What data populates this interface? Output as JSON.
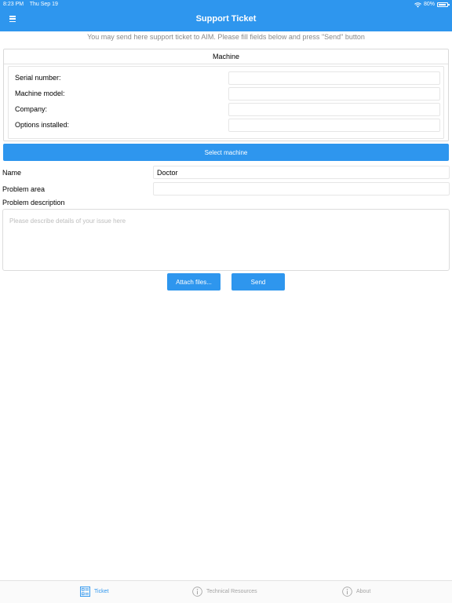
{
  "status_bar": {
    "time": "8:23 PM",
    "date": "Thu Sep 19",
    "battery": "80%"
  },
  "nav": {
    "title": "Support Ticket"
  },
  "intro_text": "You may send here support ticket to AIM. Please fill fields below and press \"Send\" button",
  "machine": {
    "title": "Machine",
    "fields": [
      {
        "label": "Serial number:",
        "value": ""
      },
      {
        "label": "Machine model:",
        "value": ""
      },
      {
        "label": "Company:",
        "value": ""
      },
      {
        "label": "Options installed:",
        "value": ""
      }
    ],
    "select_button": "Select machine"
  },
  "form": {
    "name_label": "Name",
    "name_value": "Doctor",
    "problem_area_label": "Problem area",
    "problem_area_value": "",
    "problem_description_label": "Problem description",
    "problem_description_placeholder": "Please describe details of your issue here"
  },
  "actions": {
    "attach_label": "Attach files...",
    "send_label": "Send"
  },
  "tabs": [
    {
      "label": "Ticket",
      "icon": "ticket-icon",
      "active": true
    },
    {
      "label": "Technical Resources",
      "icon": "info-icon",
      "active": false
    },
    {
      "label": "About",
      "icon": "info-icon",
      "active": false
    }
  ],
  "colors": {
    "accent": "#2e96ee",
    "inactive_tab": "#a3a3a3",
    "hint": "#888888"
  }
}
